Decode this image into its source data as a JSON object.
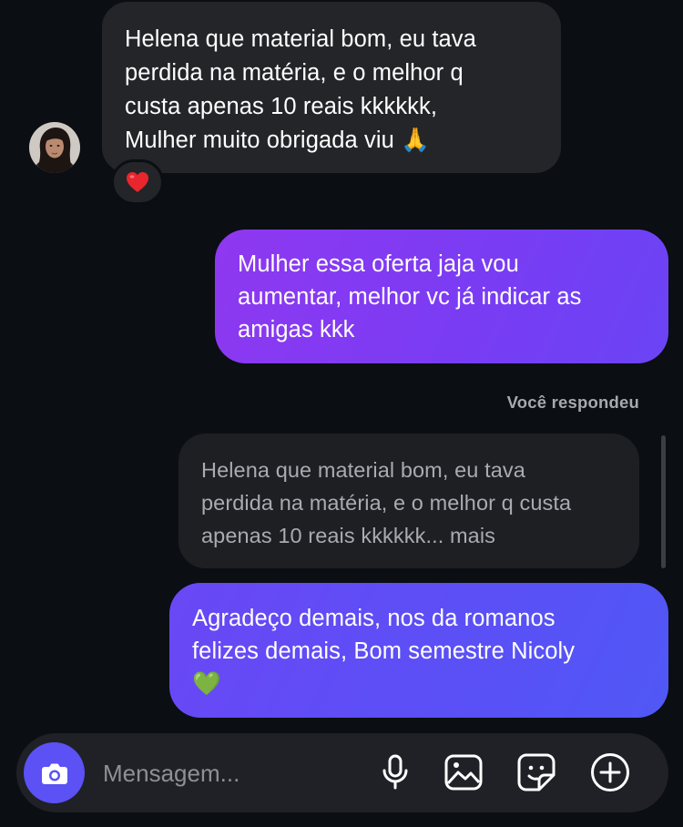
{
  "incoming": {
    "lines": [
      "Helena que material bom, eu tava",
      "perdida na matéria, e o melhor q",
      "custa apenas 10 reais kkkkkk,",
      "Mulher muito obrigada viu 🙏"
    ],
    "reaction": "❤️"
  },
  "outgoing_1": {
    "lines": [
      "Mulher essa oferta jaja vou",
      "aumentar, melhor vc já indicar as",
      "amigas kkk"
    ]
  },
  "reply_label": "Você respondeu",
  "quoted": {
    "lines": [
      "Helena que material bom, eu tava",
      "perdida na matéria, e o melhor q custa",
      "apenas 10 reais kkkkkk... mais"
    ]
  },
  "outgoing_2": {
    "lines": [
      "Agradeço demais, nos da romanos",
      "felizes demais, Bom semestre Nicoly",
      "💚"
    ]
  },
  "composer": {
    "placeholder": "Mensagem...",
    "camera_icon": "camera-icon",
    "mic_icon": "microphone-icon",
    "gallery_icon": "gallery-icon",
    "sticker_icon": "sticker-icon",
    "add_icon": "plus-circle-icon"
  },
  "colors": {
    "background": "#0b0e13",
    "incoming_bubble": "#232529",
    "outgoing_gradient_start": "#8f38f0",
    "outgoing_gradient_end": "#5058f5",
    "accent": "#5b51f4"
  }
}
